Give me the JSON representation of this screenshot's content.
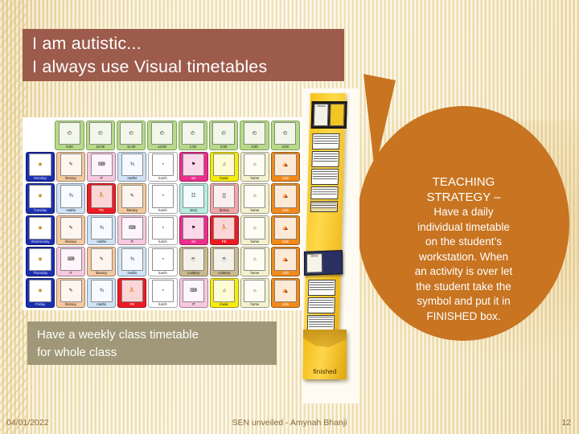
{
  "slide": {
    "title_lines": [
      "I am autistic...",
      "I always use Visual timetables"
    ],
    "title_bg": "#9c5b4b",
    "background": "#f6ecc9"
  },
  "callout": {
    "fill": "#c87421",
    "heading_lines": [
      "TEACHING",
      "STRATEGY –"
    ],
    "body_lines": [
      "Have a daily",
      "individual timetable",
      "on the student’s",
      "workstation. When",
      "an activity is over let",
      "the student take the",
      "symbol and put it in",
      "FINISHED box."
    ]
  },
  "caption": {
    "bg": "#a09878",
    "lines": [
      "Have a weekly class timetable",
      "for whole class"
    ]
  },
  "timetable": {
    "day_color": "#1c2fb0",
    "clock_color": "#b7d98a",
    "header": {
      "corner": "",
      "times": [
        "9:00",
        "10:00",
        "11:00",
        "12:00",
        "1:00",
        "2:00",
        "3:00",
        "4:00"
      ]
    },
    "rows": [
      {
        "day": "Monday",
        "cells": [
          {
            "label": "literacy",
            "color": "#f4c9a0",
            "icon": "writing-icon"
          },
          {
            "label": "IT",
            "color": "#f6c9e0",
            "icon": "computer-icon"
          },
          {
            "label": "maths",
            "color": "#cfe3f7",
            "icon": "numbers-icon"
          },
          {
            "label": "lunch",
            "color": "#ffffff",
            "icon": "plate-icon"
          },
          {
            "label": "art",
            "color": "#ec2e8c",
            "icon": "easel-icon"
          },
          {
            "label": "music",
            "color": "#f7ec12",
            "icon": "notes-icon"
          },
          {
            "label": "home",
            "color": "#f4f2cd",
            "icon": "house-icon"
          },
          {
            "label": "club",
            "color": "#f08a1c",
            "icon": "club-icon"
          }
        ]
      },
      {
        "day": "Tuesday",
        "cells": [
          {
            "label": "maths",
            "color": "#cfe3f7",
            "icon": "numbers-icon"
          },
          {
            "label": "PE",
            "color": "#ed1c24",
            "icon": "pe-icon"
          },
          {
            "label": "literacy",
            "color": "#f4c9a0",
            "icon": "writing-icon"
          },
          {
            "label": "lunch",
            "color": "#ffffff",
            "icon": "plate-icon"
          },
          {
            "label": "story",
            "color": "#b9ece0",
            "icon": "book-icon"
          },
          {
            "label": "drama",
            "color": "#f0a8a8",
            "icon": "stage-icon"
          },
          {
            "label": "home",
            "color": "#f4f2cd",
            "icon": "house-icon"
          },
          {
            "label": "club",
            "color": "#f08a1c",
            "icon": "club-icon"
          }
        ]
      },
      {
        "day": "Wednesday",
        "cells": [
          {
            "label": "literacy",
            "color": "#f4c9a0",
            "icon": "writing-icon"
          },
          {
            "label": "maths",
            "color": "#cfe3f7",
            "icon": "numbers-icon"
          },
          {
            "label": "IT",
            "color": "#f6c9e0",
            "icon": "computer-icon"
          },
          {
            "label": "lunch",
            "color": "#ffffff",
            "icon": "plate-icon"
          },
          {
            "label": "art",
            "color": "#ec2e8c",
            "icon": "easel-icon"
          },
          {
            "label": "PE",
            "color": "#ed1c24",
            "icon": "pe-icon"
          },
          {
            "label": "home",
            "color": "#f4f2cd",
            "icon": "house-icon"
          },
          {
            "label": "club",
            "color": "#f08a1c",
            "icon": "club-icon"
          }
        ]
      },
      {
        "day": "Thursday",
        "cells": [
          {
            "label": "IT",
            "color": "#f6c9e0",
            "icon": "computer-icon"
          },
          {
            "label": "literacy",
            "color": "#f4c9a0",
            "icon": "writing-icon"
          },
          {
            "label": "maths",
            "color": "#cfe3f7",
            "icon": "numbers-icon"
          },
          {
            "label": "lunch",
            "color": "#ffffff",
            "icon": "plate-icon"
          },
          {
            "label": "cookery",
            "color": "#c9b98c",
            "icon": "cooking-icon"
          },
          {
            "label": "cookery",
            "color": "#c9b98c",
            "icon": "cooking-icon"
          },
          {
            "label": "home",
            "color": "#f4f2cd",
            "icon": "house-icon"
          },
          {
            "label": "club",
            "color": "#f08a1c",
            "icon": "club-icon"
          }
        ]
      },
      {
        "day": "Friday",
        "cells": [
          {
            "label": "literacy",
            "color": "#f4c9a0",
            "icon": "writing-icon"
          },
          {
            "label": "maths",
            "color": "#cfe3f7",
            "icon": "numbers-icon"
          },
          {
            "label": "PE",
            "color": "#ed1c24",
            "icon": "pe-icon"
          },
          {
            "label": "lunch",
            "color": "#ffffff",
            "icon": "plate-icon"
          },
          {
            "label": "IT",
            "color": "#f6c9e0",
            "icon": "computer-icon"
          },
          {
            "label": "music",
            "color": "#f7ec12",
            "icon": "notes-icon"
          },
          {
            "label": "home",
            "color": "#f4f2cd",
            "icon": "house-icon"
          },
          {
            "label": "club",
            "color": "#f08a1c",
            "icon": "club-icon"
          }
        ]
      }
    ]
  },
  "strip_photo": {
    "choice_label": "choice",
    "about_label": "about",
    "finished_label": "finished"
  },
  "footer": {
    "date": "04/01/2022",
    "center": "SEN unveiled - Amynah Bhanji",
    "slide_number": "12"
  }
}
